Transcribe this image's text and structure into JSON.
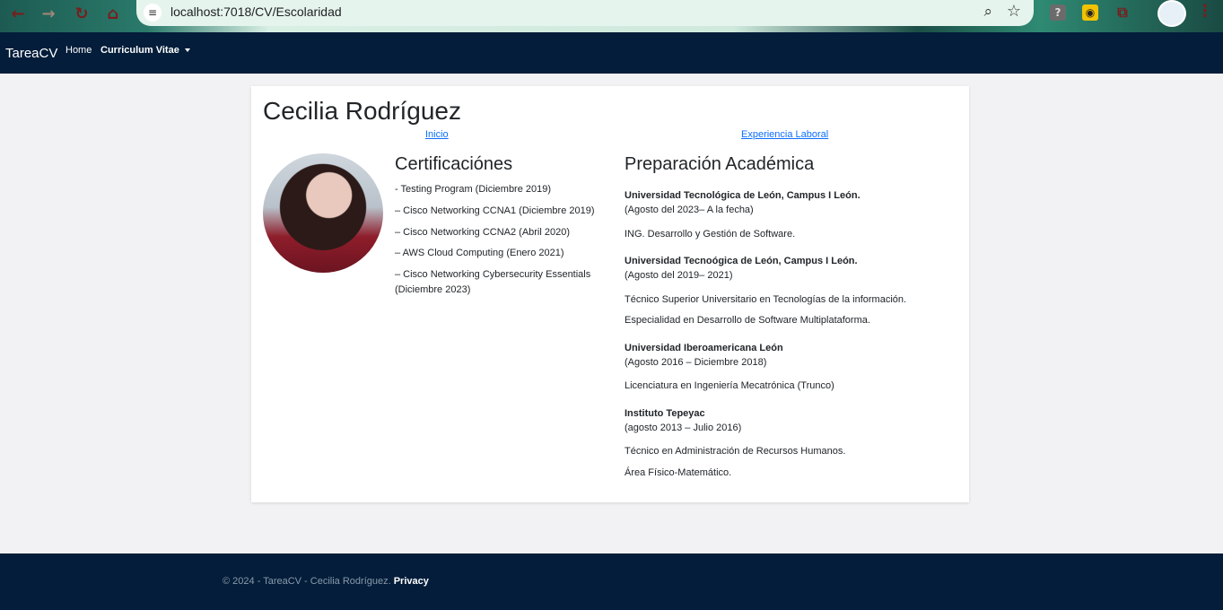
{
  "browser": {
    "url": "localhost:7018/CV/Escolaridad"
  },
  "navbar": {
    "brand": "TareaCV",
    "home": "Home",
    "cv": "Curriculum Vitae"
  },
  "profile": {
    "name": "Cecilia Rodríguez",
    "link_inicio": "Inicio",
    "link_experiencia": "Experiencia Laboral"
  },
  "certificaciones": {
    "title": "Certificaciónes",
    "items": [
      "- Testing Program (Diciembre 2019)",
      "– Cisco Networking CCNA1 (Diciembre 2019)",
      "– Cisco Networking CCNA2 (Abril 2020)",
      "– AWS Cloud Computing (Enero 2021)",
      "– Cisco Networking Cybersecurity Essentials (Diciembre 2023)"
    ]
  },
  "academica": {
    "title": "Preparación Académica",
    "entries": [
      {
        "school": "Universidad Tecnológica de León, Campus I León.",
        "dates": "(Agosto del 2023– A la fecha)",
        "details": [
          "ING. Desarrollo y Gestión de Software."
        ]
      },
      {
        "school": "Universidad Tecnoógica de León, Campus I León.",
        "dates": "(Agosto del 2019– 2021)",
        "details": [
          "Técnico Superior Universitario en Tecnologías de la información.",
          "Especialidad en Desarrollo de Software Multiplataforma."
        ]
      },
      {
        "school": "Universidad Iberoamericana León",
        "dates": "(Agosto 2016 – Diciembre 2018)",
        "details": [
          "Licenciatura en Ingeniería Mecatrónica (Trunco)"
        ]
      },
      {
        "school": "Instituto Tepeyac",
        "dates": "(agosto 2013 – Julio 2016)",
        "details": [
          "Técnico en Administración de Recursos Humanos.",
          "Área Físico-Matemático."
        ]
      }
    ]
  },
  "footer": {
    "copyright": "© 2024 - TareaCV - Cecilia Rodríguez. ",
    "privacy": "Privacy"
  }
}
